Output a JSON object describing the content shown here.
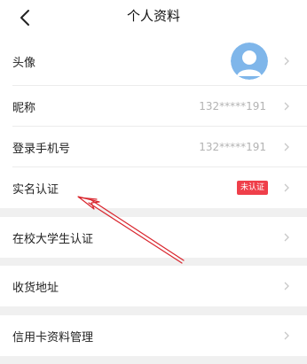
{
  "header": {
    "title": "个人资料",
    "back_icon": "chevron-left-icon"
  },
  "colors": {
    "accent_red": "#ef3f4a",
    "arrow_red": "#d9262e",
    "avatar_blue": "#7fb6ea",
    "muted_text": "#b3b3b3",
    "page_background": "#f0f0f0"
  },
  "rows": {
    "avatar": {
      "label": "头像",
      "icon": "avatar-placeholder-icon"
    },
    "nickname": {
      "label": "昵称",
      "value": "132*****191"
    },
    "phone": {
      "label": "登录手机号",
      "value": "132*****191"
    },
    "realname": {
      "label": "实名认证",
      "badge": "未认证"
    },
    "student": {
      "label": "在校大学生认证"
    },
    "address": {
      "label": "收货地址"
    },
    "creditcard": {
      "label": "信用卡资料管理"
    }
  },
  "annotation": {
    "icon": "red-arrow-icon",
    "points_to": "realname"
  }
}
